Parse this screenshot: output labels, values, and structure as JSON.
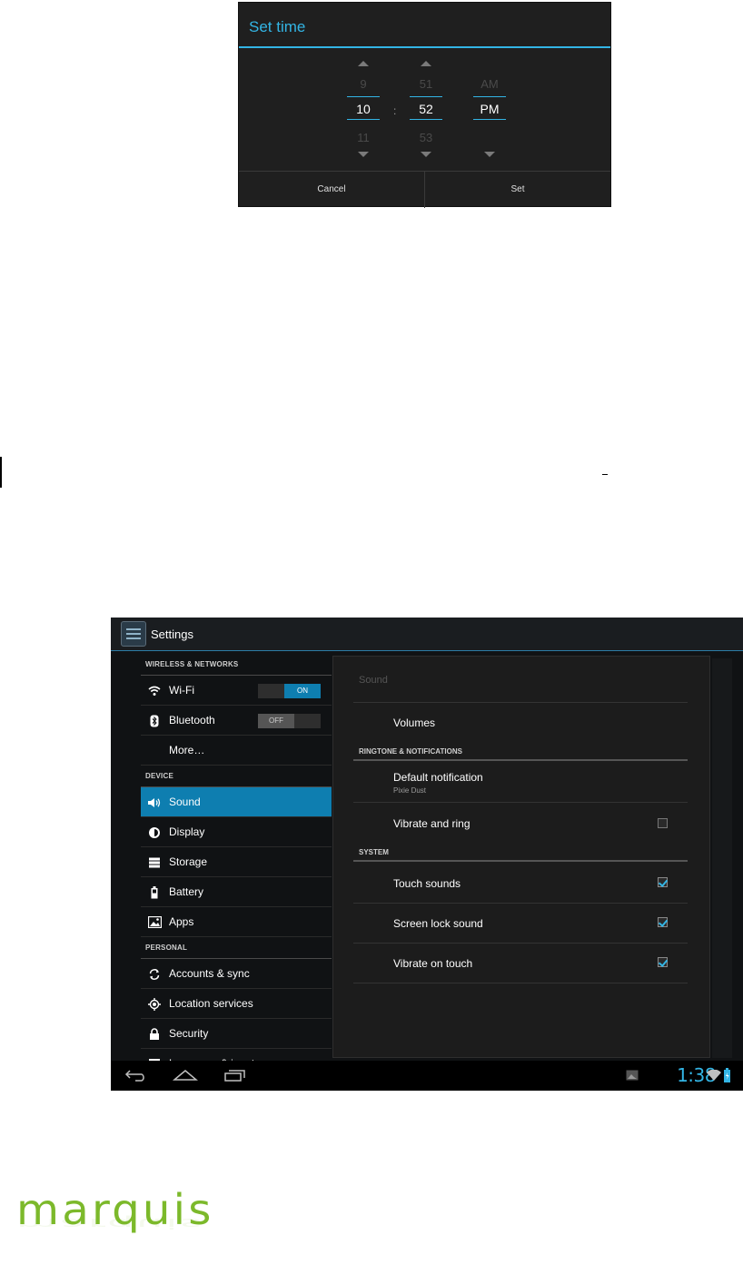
{
  "dialog": {
    "title": "Set time",
    "hour": {
      "prev": "9",
      "current": "10",
      "next": "11"
    },
    "separator": ":",
    "minute": {
      "prev": "51",
      "current": "52",
      "next": "53"
    },
    "ampm": {
      "prev": "AM",
      "current": "PM"
    },
    "cancel_label": "Cancel",
    "set_label": "Set"
  },
  "settings": {
    "app_title": "Settings",
    "sections": {
      "wireless": "WIRELESS & NETWORKS",
      "device": "DEVICE",
      "personal": "PERSONAL"
    },
    "items": {
      "wifi": "Wi-Fi",
      "wifi_toggle": "ON",
      "bluetooth": "Bluetooth",
      "bluetooth_toggle": "OFF",
      "more": "More…",
      "sound": "Sound",
      "display": "Display",
      "storage": "Storage",
      "battery": "Battery",
      "apps": "Apps",
      "accounts": "Accounts & sync",
      "location": "Location services",
      "security": "Security",
      "language": "Language & input"
    },
    "panel": {
      "title": "Sound",
      "volumes": "Volumes",
      "ringtone_header": "RINGTONE & NOTIFICATIONS",
      "default_notification": "Default notification",
      "default_notification_value": "Pixie Dust",
      "vibrate_ring": "Vibrate and ring",
      "system_header": "SYSTEM",
      "touch_sounds": "Touch sounds",
      "screen_lock_sound": "Screen lock sound",
      "vibrate_touch": "Vibrate on touch"
    },
    "checks": {
      "vibrate_ring": false,
      "touch_sounds": true,
      "screen_lock_sound": true,
      "vibrate_touch": true
    },
    "status_time": "1:38",
    "colors": {
      "accent": "#33b5e5",
      "selected": "#0e7eb0"
    }
  },
  "brand": {
    "logo_text": "marquis",
    "logo_color": "#7cb92b"
  }
}
